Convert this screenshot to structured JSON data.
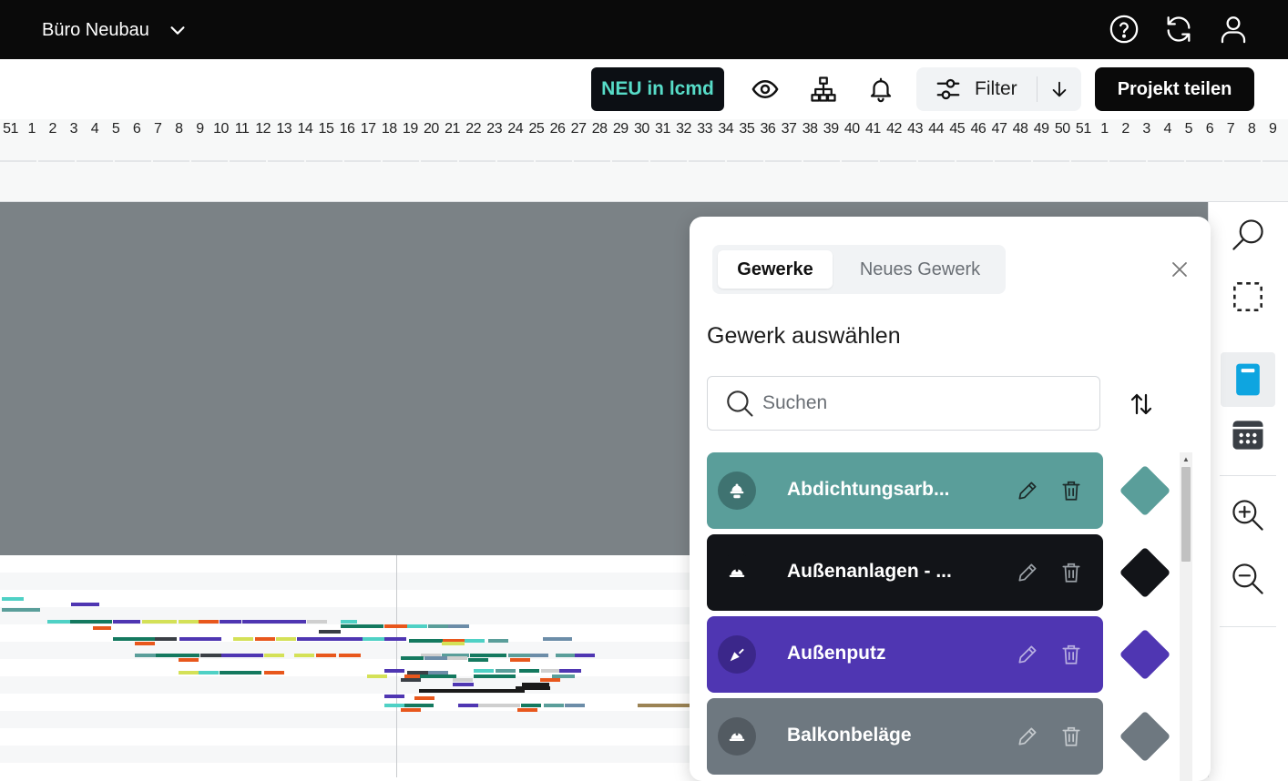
{
  "header": {
    "project_name": "Büro Neubau",
    "icons": [
      "help-circle-icon",
      "sync-icon",
      "user-icon"
    ]
  },
  "toolbar": {
    "new_badge": "NEU in lcmd",
    "filter_label": "Filter",
    "share_label": "Projekt teilen",
    "icons": [
      "eye-icon",
      "hierarchy-icon",
      "bell-icon",
      "sliders-icon",
      "arrow-down-icon"
    ]
  },
  "timeline": {
    "week_numbers": [
      "51",
      "1",
      "2",
      "3",
      "4",
      "5",
      "6",
      "7",
      "8",
      "9",
      "10",
      "11",
      "12",
      "13",
      "14",
      "15",
      "16",
      "17",
      "18",
      "19",
      "20",
      "21",
      "22",
      "23",
      "24",
      "25",
      "26",
      "27",
      "28",
      "29",
      "30",
      "31",
      "32",
      "33",
      "34",
      "35",
      "36",
      "37",
      "38",
      "39",
      "40",
      "41",
      "42",
      "43",
      "44",
      "45",
      "46",
      "47",
      "48",
      "49",
      "50",
      "51",
      "1",
      "2",
      "3",
      "4",
      "5",
      "6",
      "7",
      "8",
      "9"
    ]
  },
  "right_rail": {
    "tools": [
      "search-icon",
      "selection-icon",
      "trade-book-icon",
      "calendar-icon",
      "zoom-in-icon",
      "zoom-out-icon"
    ],
    "active_tool": "trade-book-icon"
  },
  "panel": {
    "tabs": [
      {
        "label": "Gewerke",
        "active": true
      },
      {
        "label": "Neues Gewerk",
        "active": false
      }
    ],
    "heading": "Gewerk auswählen",
    "search_placeholder": "Suchen",
    "trades": [
      {
        "name": "Abdichtungsarb...",
        "color": "#5a9e9a",
        "icon": "hard-hat-icon"
      },
      {
        "name": "Außenanlagen - ...",
        "color": "#121418",
        "icon": "hard-hat-icon"
      },
      {
        "name": "Außenputz",
        "color": "#4f36b2",
        "icon": "trowel-icon"
      },
      {
        "name": "Balkonbeläge",
        "color": "#6e7880",
        "icon": "hard-hat-icon"
      }
    ]
  }
}
